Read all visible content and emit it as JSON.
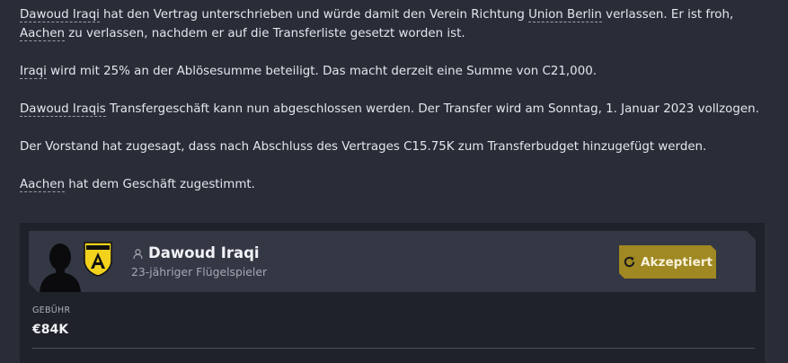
{
  "message": {
    "p1_pre": "",
    "p1_player": "Dawoud Iraqi",
    "p1_mid": " hat den Vertrag unterschrieben und würde damit den Verein Richtung ",
    "p1_club": "Union Berlin",
    "p1_mid2": " verlassen. Er ist froh, ",
    "p1_club2": "Aachen",
    "p1_end": " zu verlassen, nachdem er auf die Transferliste gesetzt worden ist.",
    "p2_player": "Iraqi",
    "p2_text": " wird mit 25% an der Ablösesumme beteiligt. Das macht derzeit eine Summe von C21,000.",
    "p3_player": "Dawoud Iraqis",
    "p3_text": " Transfergeschäft kann nun abgeschlossen werden. Der Transfer wird am Sonntag, 1. Januar 2023 vollzogen.",
    "p4_text": "Der Vorstand hat zugesagt, dass nach Abschluss des Vertrages C15.75K zum Transferbudget hinzugefügt werden.",
    "p5_club": "Aachen",
    "p5_text": " hat dem Geschäft zugestimmt."
  },
  "card": {
    "player_name": "Dawoud Iraqi",
    "player_sub": "23-jähriger Flügelspieler",
    "status_label": "Akzeptiert",
    "fee_label": "GEBÜHR",
    "fee_value": "€84K",
    "colors": {
      "status_bg": "#a08822",
      "card_bg": "#1f212b",
      "head_bg": "#343744"
    }
  }
}
